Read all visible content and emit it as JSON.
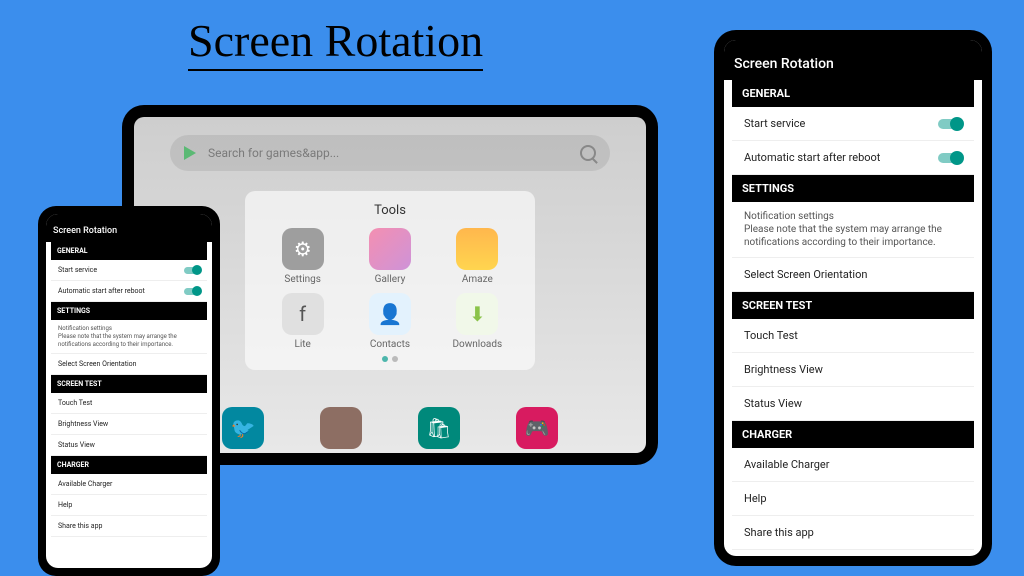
{
  "title": "Screen Rotation",
  "tablet": {
    "search_placeholder": "Search for games&app...",
    "tools_title": "Tools",
    "tools": [
      {
        "label": "Settings"
      },
      {
        "label": "Gallery"
      },
      {
        "label": "Amaze"
      },
      {
        "label": "Lite"
      },
      {
        "label": "Contacts"
      },
      {
        "label": "Downloads"
      }
    ]
  },
  "app": {
    "header": "Screen Rotation",
    "sections": {
      "general": "GENERAL",
      "settings": "SETTINGS",
      "screen_test": "SCREEN TEST",
      "charger": "CHARGER"
    },
    "items": {
      "start_service": "Start service",
      "auto_reboot": "Automatic start after reboot",
      "notif_title": "Notification settings",
      "notif_desc": "Please note that the system may arrange the notifications according to their importance.",
      "select_orientation": "Select Screen Orientation",
      "touch_test": "Touch Test",
      "brightness": "Brightness View",
      "status_view": "Status View",
      "available_charger": "Available Charger",
      "help": "Help",
      "share": "Share this app"
    }
  }
}
